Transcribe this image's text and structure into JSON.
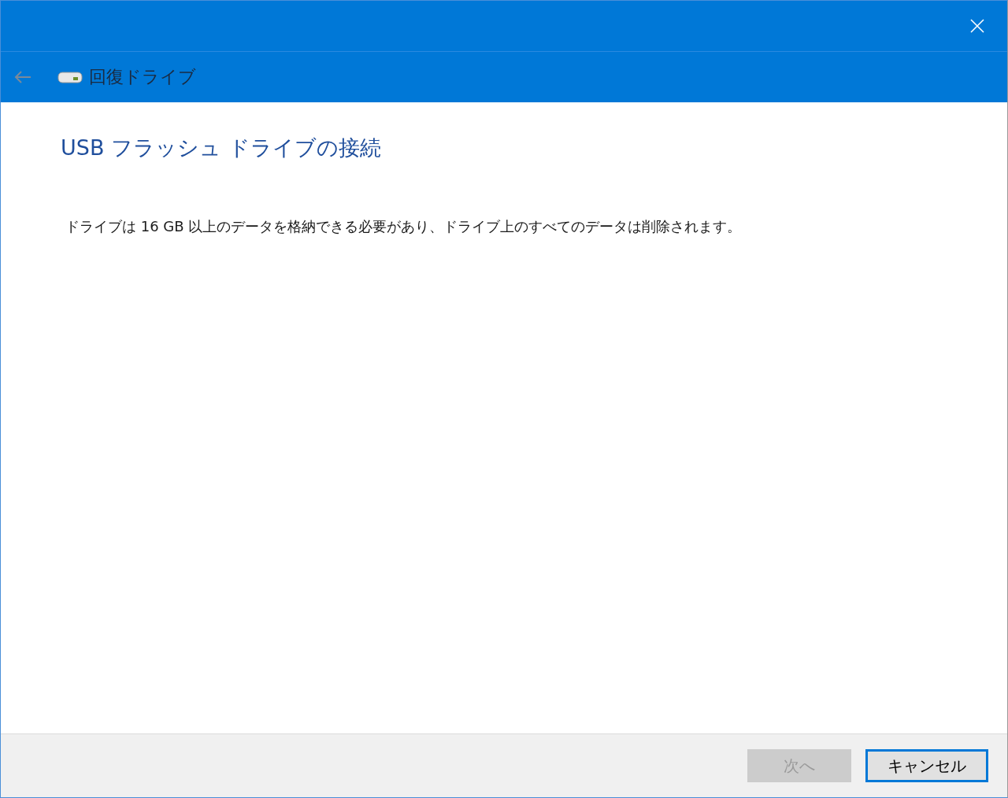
{
  "window": {
    "title": "回復ドライブ",
    "back_disabled": true
  },
  "heading": "USB フラッシュ ドライブの接続",
  "description": "ドライブは 16 GB 以上のデータを格納できる必要があり、ドライブ上のすべてのデータは削除されます。",
  "buttons": [
    {
      "label": "次へ",
      "disabled": true,
      "default": false
    },
    {
      "label": "キャンセル",
      "disabled": false,
      "default": true
    }
  ]
}
